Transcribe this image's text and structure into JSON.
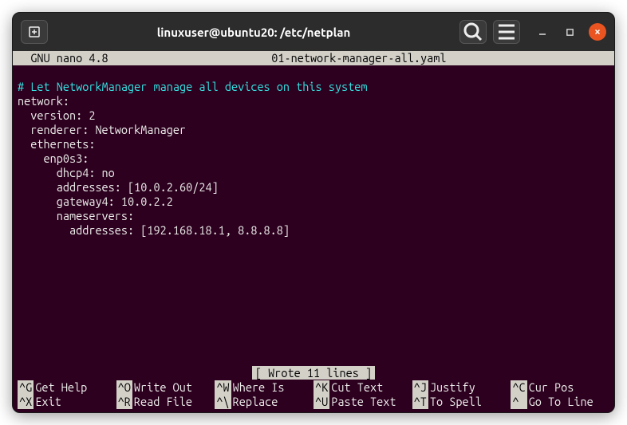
{
  "window": {
    "title": "linuxuser@ubuntu20: /etc/netplan"
  },
  "nano": {
    "app_label": "  GNU nano 4.8",
    "filename": "01-network-manager-all.yaml",
    "status": "[ Wrote 11 lines ]"
  },
  "file_content": {
    "line1": "# Let NetworkManager manage all devices on this system",
    "line2": "network:",
    "line3": "  version: 2",
    "line4": "  renderer: NetworkManager",
    "line5": "  ethernets:",
    "line6": "    enp0s3:",
    "line7": "      dhcp4: no",
    "line8": "      addresses: [10.0.2.60/24]",
    "line9": "      gateway4: 10.0.2.2",
    "line10": "      nameservers:",
    "line11": "        addresses: [192.168.18.1, 8.8.8.8]"
  },
  "shortcuts": {
    "row1": [
      {
        "key": "^G",
        "label": "Get Help"
      },
      {
        "key": "^O",
        "label": "Write Out"
      },
      {
        "key": "^W",
        "label": "Where Is"
      },
      {
        "key": "^K",
        "label": "Cut Text"
      },
      {
        "key": "^J",
        "label": "Justify"
      },
      {
        "key": "^C",
        "label": "Cur Pos"
      }
    ],
    "row2": [
      {
        "key": "^X",
        "label": "Exit"
      },
      {
        "key": "^R",
        "label": "Read File"
      },
      {
        "key": "^\\",
        "label": "Replace"
      },
      {
        "key": "^U",
        "label": "Paste Text"
      },
      {
        "key": "^T",
        "label": "To Spell"
      },
      {
        "key": "^ ",
        "label": "Go To Line"
      }
    ]
  }
}
